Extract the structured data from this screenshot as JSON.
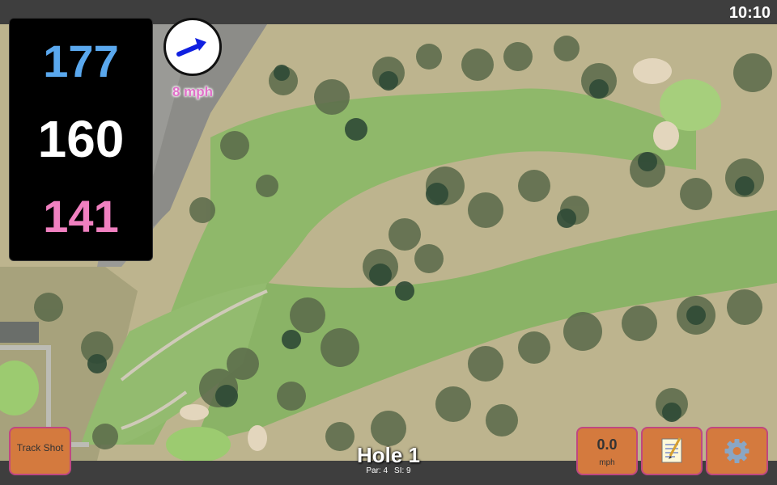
{
  "status": {
    "time": "10:10"
  },
  "distances": {
    "back": "177",
    "middle": "160",
    "front": "141"
  },
  "wind": {
    "speed_label": "8 mph",
    "icon": "wind-arrow-icon"
  },
  "hole": {
    "title": "Hole 1",
    "par_label": "Par: 4",
    "si_label": "SI: 9"
  },
  "buttons": {
    "track_shot": "Track Shot",
    "speed_value": "0.0",
    "speed_unit": "mph",
    "notes_icon": "notepad-icon",
    "settings_icon": "gear-icon"
  },
  "colors": {
    "back_distance": "#5aa8ee",
    "middle_distance": "#ffffff",
    "front_distance": "#f080c0",
    "button_bg": "#d47a3e",
    "wind_text": "#e070c8",
    "fairway": "#8fb86a"
  }
}
